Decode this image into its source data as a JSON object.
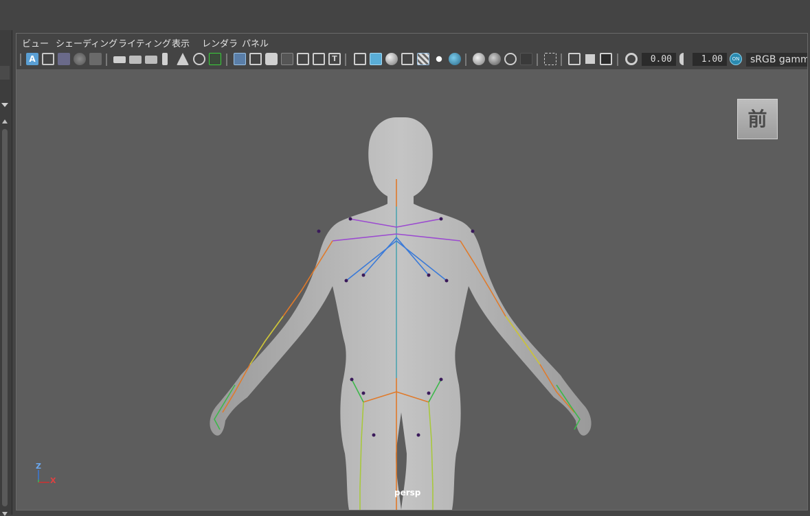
{
  "menubar": {
    "items": [
      "ビュー",
      "シェーディング",
      "ライティング",
      "表示",
      "レンダラ",
      "パネル"
    ]
  },
  "toolbar": {
    "exposure_value": "0.00",
    "gamma_value": "1.00",
    "colorspace_label": "sRGB gamma",
    "color_management_badge": "ON"
  },
  "viewport": {
    "viewcube_label": "前",
    "camera_label": "persp",
    "axis_up": "Z",
    "axis_right": "X",
    "background_color": "#5d5d5d",
    "model": "human-body-with-skeleton-rig"
  },
  "colors": {
    "ui_background": "#444444",
    "viewport_background": "#5d5d5d",
    "accent_blue": "#5a9fd4",
    "skeleton_spine": "#49b0c8",
    "skeleton_clavicle": "#9b4ad0",
    "skeleton_arm": "#e07a2a",
    "skeleton_leg": "#a8c83c"
  }
}
